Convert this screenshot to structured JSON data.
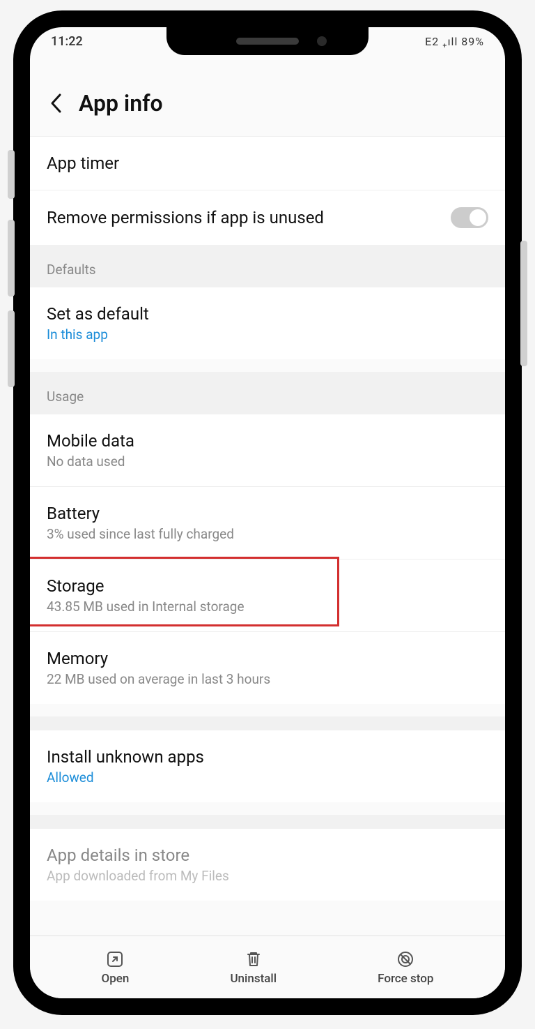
{
  "status_bar": {
    "time": "11:22",
    "right": "E2 ₊ıll 89%"
  },
  "header": {
    "title": "App info"
  },
  "items": {
    "app_timer": {
      "label": "App timer"
    },
    "remove_perms": {
      "label": "Remove permissions if app is unused"
    }
  },
  "sections": {
    "defaults": {
      "header": "Defaults",
      "set_default": {
        "label": "Set as default",
        "sublabel": "In this app"
      }
    },
    "usage": {
      "header": "Usage",
      "mobile_data": {
        "label": "Mobile data",
        "sublabel": "No data used"
      },
      "battery": {
        "label": "Battery",
        "sublabel": "3% used since last fully charged"
      },
      "storage": {
        "label": "Storage",
        "sublabel": "43.85 MB used in Internal storage"
      },
      "memory": {
        "label": "Memory",
        "sublabel": "22 MB used on average in last 3 hours"
      }
    },
    "install_unknown": {
      "label": "Install unknown apps",
      "sublabel": "Allowed"
    },
    "app_details": {
      "label": "App details in store",
      "sublabel": "App downloaded from My Files"
    }
  },
  "bottom": {
    "open": "Open",
    "uninstall": "Uninstall",
    "force_stop": "Force stop"
  }
}
